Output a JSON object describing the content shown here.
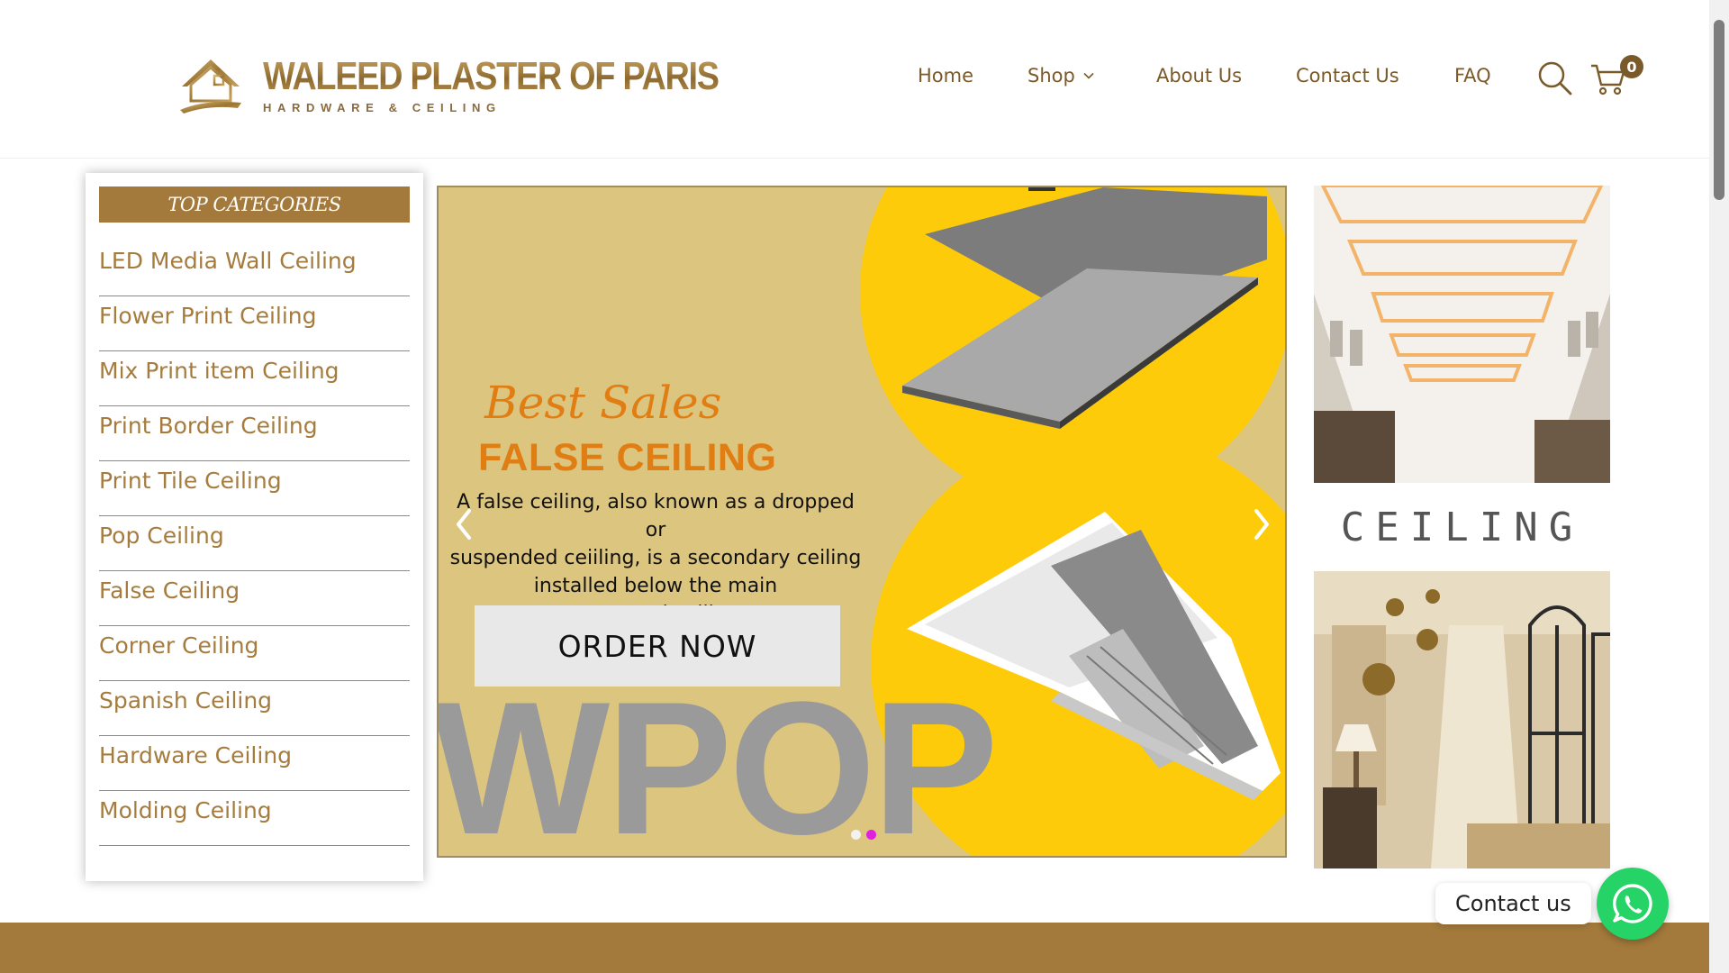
{
  "header": {
    "logo_title": "WALEED PLASTER OF PARIS",
    "logo_subtitle": "HARDWARE & CEILING",
    "nav": {
      "home": "Home",
      "shop": "Shop",
      "about": "About Us",
      "contact": "Contact Us",
      "faq": "FAQ"
    },
    "cart_count": "0",
    "icons": [
      "search-icon",
      "cart-icon",
      "chevron-down-icon"
    ]
  },
  "sidebar": {
    "title": "TOP CATEGORIES",
    "items": [
      {
        "label": "LED Media Wall Ceiling"
      },
      {
        "label": "Flower Print Ceiling"
      },
      {
        "label": "Mix Print item Ceiling"
      },
      {
        "label": "Print Border Ceiling"
      },
      {
        "label": "Print Tile Ceiling"
      },
      {
        "label": "Pop Ceiling"
      },
      {
        "label": "False Ceiling"
      },
      {
        "label": "Corner Ceiling"
      },
      {
        "label": "Spanish Ceiling"
      },
      {
        "label": "Hardware Ceiling"
      },
      {
        "label": "Molding Ceiling"
      }
    ]
  },
  "slider": {
    "headline": "Best Sales",
    "subheadline": "FALSE CEILING",
    "description_lines": [
      "A false ceiling, also known as a dropped or",
      "suspended ceiiling, is a secondary ceiling",
      "installed below the main",
      "structural ceiling"
    ],
    "order_button": "ORDER NOW",
    "watermark": "WPOP",
    "slide_count": 2,
    "active_slide": 2
  },
  "right_panel": {
    "ceiling_word": "CEILING"
  },
  "contact": {
    "label": "Contact us"
  },
  "colors": {
    "brand_gold": "#a37a3b",
    "slider_bg": "#dcc57f",
    "slider_yellow": "#fecb0b",
    "headline_orange": "#e07e14",
    "whatsapp_green": "#25d366",
    "active_dot": "#e020e0"
  }
}
